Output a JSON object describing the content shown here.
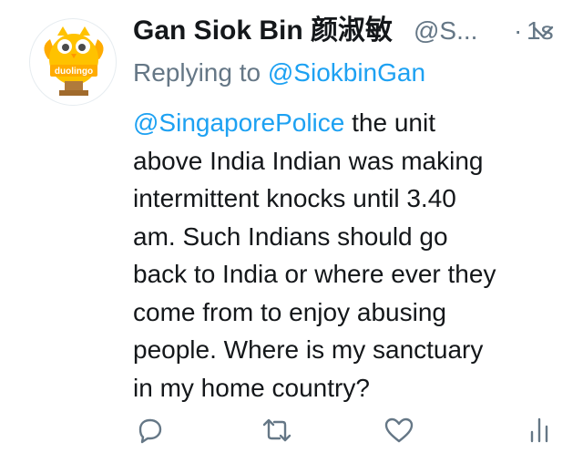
{
  "tweet": {
    "author": {
      "display_name": "Gan Siok Bin 颜淑敏",
      "handle": "@S...",
      "avatar_logo_text": "duolingo"
    },
    "separator": "·",
    "timestamp": "1s",
    "reply_prefix": "Replying to",
    "reply_to": "@SiokbinGan",
    "body_lines": [
      {
        "mention": "@SingaporePolice",
        "text": " the unit"
      },
      {
        "text": "above India Indian was making"
      },
      {
        "text": "intermittent knocks until 3.40"
      },
      {
        "text": "am. Such Indians should go"
      },
      {
        "text": "back to India or where ever they"
      },
      {
        "text": "come from to enjoy abusing"
      },
      {
        "text": "people. Where is my sanctuary"
      },
      {
        "text": "in my home country?"
      }
    ]
  },
  "actions": {
    "reply_icon": "reply-icon",
    "retweet_icon": "retweet-icon",
    "like_icon": "heart-icon",
    "analytics_icon": "analytics-icon",
    "more_icon": "chevron-down-icon"
  },
  "colors": {
    "accent": "#1da1f2",
    "secondary_text": "#657786",
    "primary_text": "#14171a",
    "icon_gray": "#657786",
    "owl_yellow": "#ffc200",
    "owl_dark": "#ffab00",
    "trophy_brown": "#b07a3b"
  }
}
